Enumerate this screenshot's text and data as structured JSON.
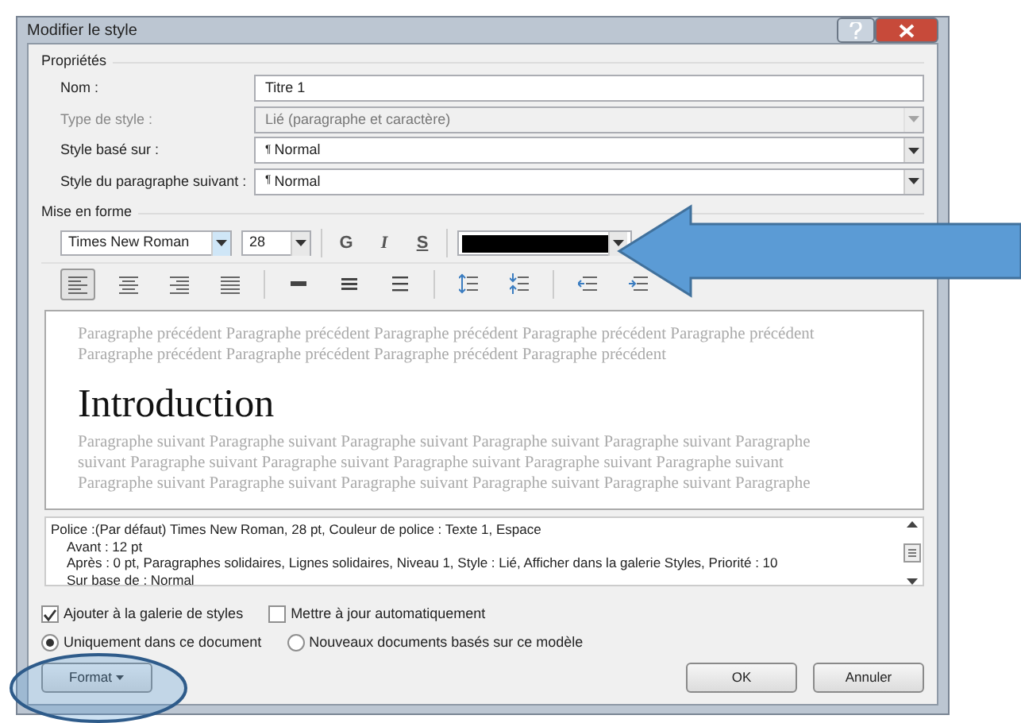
{
  "window": {
    "title": "Modifier le style"
  },
  "properties": {
    "legend": "Propriétés",
    "fields": [
      {
        "label": "Nom :",
        "value": "Titre 1",
        "kind": "text",
        "disabled": false
      },
      {
        "label": "Type de style :",
        "value": "Lié (paragraphe et caractère)",
        "kind": "combo",
        "disabled": true
      },
      {
        "label": "Style basé sur :",
        "symbol": "¶",
        "value": "Normal",
        "kind": "combo",
        "disabled": false
      },
      {
        "label": "Style du paragraphe suivant :",
        "symbol": "¶",
        "value": "Normal",
        "kind": "combo",
        "disabled": false
      }
    ]
  },
  "formatting": {
    "legend": "Mise en forme",
    "font": "Times New Roman",
    "size": "28",
    "styles": [
      {
        "label": "G",
        "kind": "bold"
      },
      {
        "label": "I",
        "kind": "italic"
      },
      {
        "label": "S",
        "kind": "underline"
      }
    ],
    "color": "#000000",
    "paragraph_buttons": [
      {
        "kind": "align-left",
        "selected": true
      },
      {
        "kind": "align-center",
        "selected": false
      },
      {
        "kind": "align-right",
        "selected": false
      },
      {
        "kind": "justify",
        "selected": false
      },
      {
        "kind": "single",
        "selected": false
      },
      {
        "kind": "one-half",
        "selected": false
      },
      {
        "kind": "double",
        "selected": false
      },
      {
        "kind": "space-increase",
        "selected": false
      },
      {
        "kind": "space-decrease",
        "selected": false
      },
      {
        "kind": "indent-decrease",
        "selected": false
      },
      {
        "kind": "indent-increase",
        "selected": false
      }
    ]
  },
  "preview": {
    "before": [
      "Paragraphe précédent Paragraphe précédent Paragraphe précédent Paragraphe précédent Paragraphe précédent",
      "Paragraphe précédent Paragraphe précédent Paragraphe précédent Paragraphe précédent"
    ],
    "heading": "Introduction",
    "after": [
      "Paragraphe suivant Paragraphe suivant Paragraphe suivant Paragraphe suivant Paragraphe suivant Paragraphe",
      "suivant Paragraphe suivant Paragraphe suivant Paragraphe suivant Paragraphe suivant Paragraphe suivant",
      "Paragraphe suivant Paragraphe suivant Paragraphe suivant Paragraphe suivant Paragraphe suivant Paragraphe"
    ]
  },
  "description": [
    "Police :(Par défaut) Times New Roman, 28 pt, Couleur de police : Texte 1, Espace",
    "Avant : 12 pt",
    "Après : 0 pt, Paragraphes solidaires, Lignes solidaires, Niveau 1, Style : Lié, Afficher dans la galerie Styles, Priorité : 10",
    "Sur base de : Normal"
  ],
  "checkboxes": [
    {
      "label": "Ajouter à la galerie de styles",
      "checked": true
    },
    {
      "label": "Mettre à jour automatiquement",
      "checked": false
    }
  ],
  "radios": [
    {
      "label": "Uniquement dans ce document",
      "selected": true
    },
    {
      "label": "Nouveaux documents basés sur ce modèle",
      "selected": false
    }
  ],
  "buttons": [
    {
      "label": "Format",
      "kind": "menu"
    },
    {
      "label": "OK",
      "kind": "ok"
    },
    {
      "label": "Annuler",
      "kind": "cancel"
    }
  ]
}
